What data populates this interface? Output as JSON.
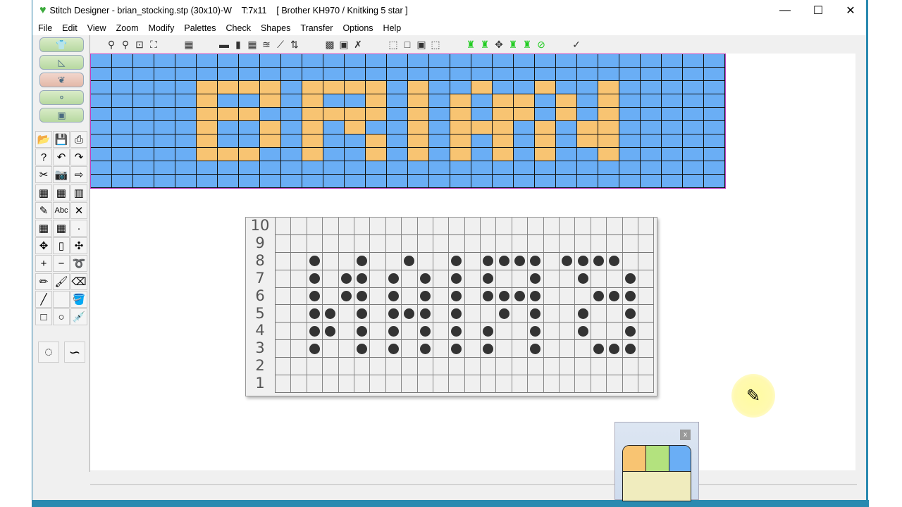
{
  "window": {
    "title": "Stitch Designer - brian_stocking.stp (30x10)-W    T:7x11    [ Brother KH970 / Knitking 5 star ]",
    "controls": [
      "minimize",
      "maximize",
      "close"
    ]
  },
  "menu": [
    "File",
    "Edit",
    "View",
    "Zoom",
    "Modify",
    "Palettes",
    "Check",
    "Shapes",
    "Transfer",
    "Options",
    "Help"
  ],
  "colors": {
    "background": "#6aaef5",
    "contrast": "#f8c472",
    "green": "#b3e27e",
    "cream": "#f0ecbe",
    "grid_border": "#c040c0"
  },
  "design_grid": {
    "columns": 30,
    "rows": 10,
    "pattern": [
      "000000000000000000000000000000",
      "000000000000000000000000000000",
      "000001111011110100100100100000",
      "000001001010010101011010100000",
      "000001110011110101011010100000",
      "000001001010100101110101100000",
      "000001001010010101010101100000",
      "000001110010010101010100100000",
      "000000000000000000000000000000",
      "000000000000000000000000000000"
    ]
  },
  "punchcard": {
    "row_labels": [
      "10",
      "9",
      "8",
      "7",
      "6",
      "5",
      "4",
      "3",
      "2",
      "1"
    ],
    "columns": 24,
    "rows": [
      "000000000000000000000000",
      "000000000000000000000000",
      "001001001001011110111100",
      "001011010101010010010010",
      "001011010101011110001110",
      "001101011101001010010010",
      "001101010101010010010010",
      "001001010101010010001110",
      "000000000000000000000000",
      "000000000000000000000000"
    ]
  },
  "palette_window": {
    "close_label": "x"
  }
}
